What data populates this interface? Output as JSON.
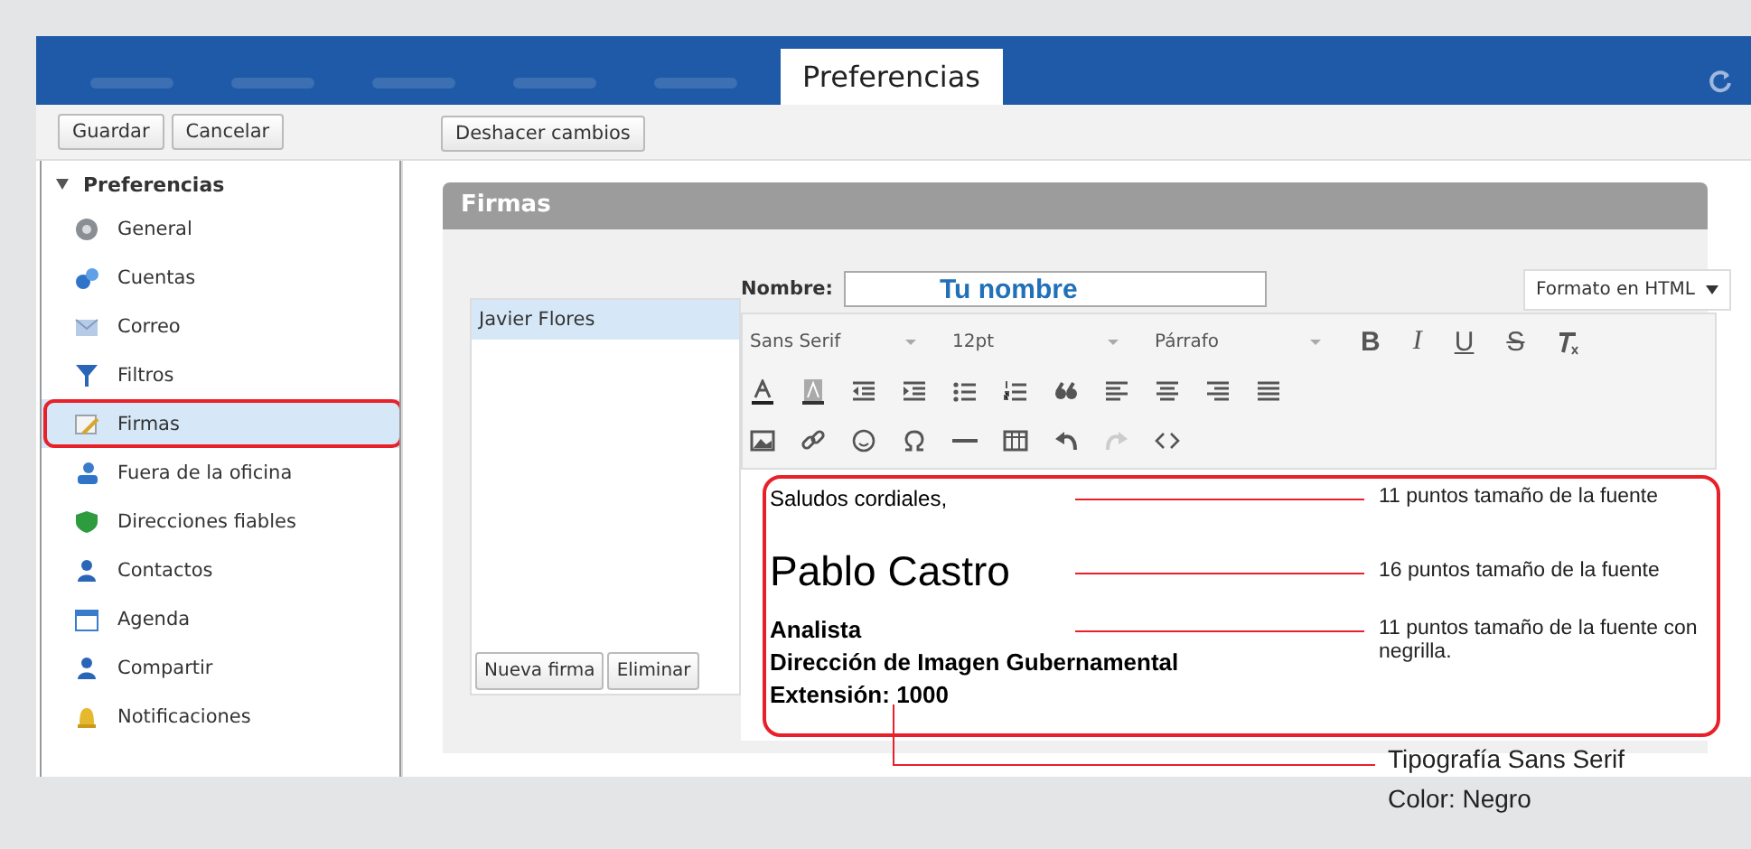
{
  "tabs": [
    {
      "selected": false
    },
    {
      "selected": false
    },
    {
      "selected": false
    },
    {
      "selected": false
    },
    {
      "selected": false
    },
    {
      "label": "Preferencias",
      "selected": true
    }
  ],
  "toolbar": {
    "left_buttons": [
      "Guardar",
      "Cancelar"
    ],
    "right_buttons": [
      "Deshacer cambios"
    ]
  },
  "sidebar": {
    "title": "Preferencias",
    "expanded": true,
    "items": [
      {
        "label": "General",
        "selected": false,
        "highlighted": false
      },
      {
        "label": "Cuentas",
        "selected": false,
        "highlighted": false
      },
      {
        "label": "Correo",
        "selected": false,
        "highlighted": false
      },
      {
        "label": "Filtros",
        "selected": false,
        "highlighted": false
      },
      {
        "label": "Firmas",
        "selected": true,
        "highlighted": true
      },
      {
        "label": "Fuera de la oficina",
        "selected": false,
        "highlighted": false
      },
      {
        "label": "Direcciones fiables",
        "selected": false,
        "highlighted": false
      },
      {
        "label": "Contactos",
        "selected": false,
        "highlighted": false
      },
      {
        "label": "Agenda",
        "selected": false,
        "highlighted": false
      },
      {
        "label": "Compartir",
        "selected": false,
        "highlighted": false
      },
      {
        "label": "Notificaciones",
        "selected": false,
        "highlighted": false
      }
    ]
  },
  "section": {
    "title": "Firmas"
  },
  "signatures": {
    "items": [
      {
        "label": "Javier Flores",
        "selected": true
      }
    ],
    "buttons": [
      "Nueva firma",
      "Eliminar"
    ]
  },
  "name_field": {
    "label": "Nombre:",
    "value": "Tu nombre"
  },
  "format_dropdown": {
    "value": "Formato en HTML"
  },
  "editor_toolbar": {
    "font": "Sans Serif",
    "size": "12pt",
    "block": "Párrafo",
    "styles": [
      "B",
      "I",
      "U",
      "S"
    ]
  },
  "signature_body": [
    {
      "text": "Saludos cordiales,",
      "kind": "normal",
      "note": "11 puntos tamaño de la fuente"
    },
    {
      "text": "Pablo Castro",
      "kind": "large",
      "note": "16 puntos tamaño de la fuente"
    },
    {
      "text": "Analista",
      "kind": "bold",
      "note": "11 puntos tamaño de la fuente con negrilla."
    },
    {
      "text": "Dirección de Imagen Gubernamental",
      "kind": "bold"
    },
    {
      "text": "Extensión: 1000",
      "kind": "bold"
    }
  ],
  "typography_notes": [
    "Tipografía Sans Serif",
    "Color: Negro"
  ]
}
